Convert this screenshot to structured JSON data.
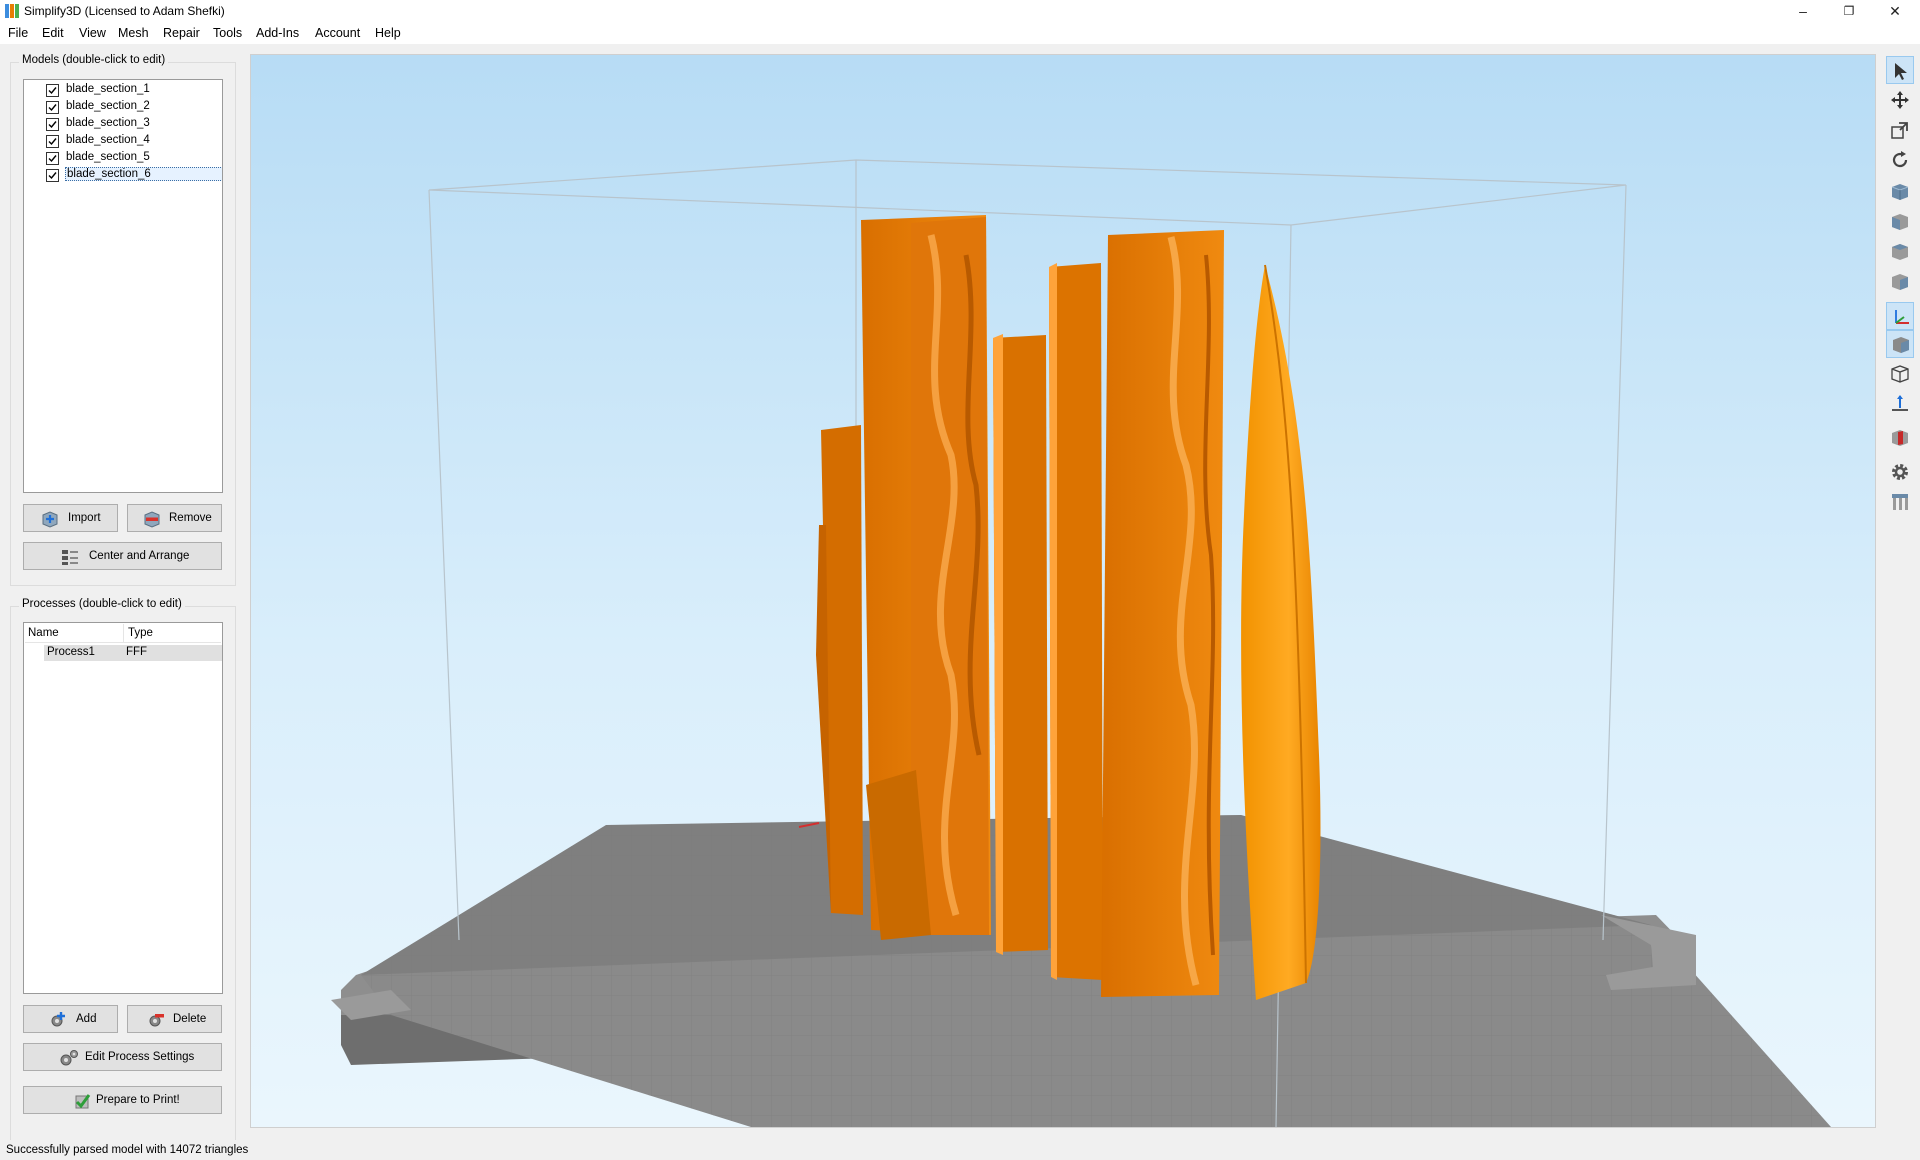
{
  "window": {
    "title": "Simplify3D (Licensed to Adam Shefki)",
    "controls": {
      "minimize": "–",
      "restore": "❐",
      "close": "✕"
    }
  },
  "menu": [
    "File",
    "Edit",
    "View",
    "Mesh",
    "Repair",
    "Tools",
    "Add-Ins",
    "Account",
    "Help"
  ],
  "models_panel": {
    "title": "Models (double-click to edit)",
    "items": [
      {
        "label": "blade_section_1",
        "checked": true
      },
      {
        "label": "blade_section_2",
        "checked": true
      },
      {
        "label": "blade_section_3",
        "checked": true
      },
      {
        "label": "blade_section_4",
        "checked": true
      },
      {
        "label": "blade_section_5",
        "checked": true
      },
      {
        "label": "blade_section_6",
        "checked": true,
        "selected": true
      }
    ],
    "import_label": "Import",
    "remove_label": "Remove",
    "center_label": "Center and Arrange"
  },
  "processes_panel": {
    "title": "Processes (double-click to edit)",
    "columns": [
      "Name",
      "Type"
    ],
    "rows": [
      {
        "name": "Process1",
        "type": "FFF"
      }
    ],
    "add_label": "Add",
    "delete_label": "Delete",
    "edit_label": "Edit Process Settings",
    "prepare_label": "Prepare to Print!"
  },
  "status": {
    "text": "Successfully parsed model with 14072 triangles"
  },
  "colors": {
    "model_orange": "#e87e04",
    "model_orange_dark": "#c96a00",
    "model_highlight": "#ffa31a",
    "bed_gray": "#8c8c8c",
    "bed_grid": "#777777",
    "toolbar_active": "#cce4f7"
  },
  "toolbar_icons": [
    "select-cursor-icon",
    "move-icon",
    "scale-icon",
    "rotate-icon",
    "view-default-cube-icon",
    "view-front-cube-icon",
    "view-top-cube-icon",
    "view-side-cube-icon",
    "axes-icon",
    "solid-cube-icon",
    "wireframe-cube-icon",
    "build-direction-icon",
    "cross-section-icon",
    "gear-icon",
    "supports-icon"
  ]
}
